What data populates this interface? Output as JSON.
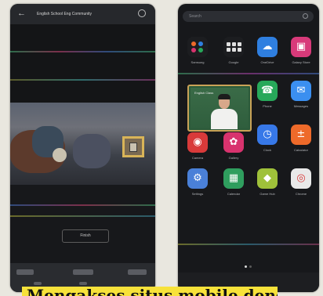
{
  "left_screen": {
    "title": "English School Eng Community",
    "back_icon": "arrow-left-icon",
    "menu_icon": "more-options-icon",
    "video_caption": "",
    "action_button": "Finish",
    "colors": {
      "background": "#1b1d20",
      "frame": "#d8b458"
    }
  },
  "right_screen": {
    "search_placeholder": "Search",
    "search_icon": "search-icon",
    "apps": [
      {
        "label": "Samsung",
        "color": "#1c1d20",
        "icon": "samsung-folder-icon"
      },
      {
        "label": "Google",
        "color": "#1c1d20",
        "icon": "google-folder-icon"
      },
      {
        "label": "OneDrive",
        "color": "#2f7fe0",
        "icon": "cloud-icon"
      },
      {
        "label": "Galaxy Store",
        "color": "#d83a7a",
        "icon": "store-bag-icon"
      },
      {
        "label": "Phone",
        "color": "#27a85a",
        "icon": "phone-icon"
      },
      {
        "label": "Messages",
        "color": "#3b8ff0",
        "icon": "message-icon"
      },
      {
        "label": "Camera",
        "color": "#d93a3a",
        "icon": "camera-icon"
      },
      {
        "label": "Gallery",
        "color": "#d8336e",
        "icon": "flower-icon"
      },
      {
        "label": "Clock",
        "color": "#3778e8",
        "icon": "clock-icon"
      },
      {
        "label": "Calculator",
        "color": "#ee6a2a",
        "icon": "calculator-icon"
      },
      {
        "label": "Settings",
        "color": "#4a80d8",
        "icon": "gear-icon"
      },
      {
        "label": "Calendar",
        "color": "#2f9e5e",
        "icon": "calendar-icon"
      },
      {
        "label": "Game Hub",
        "color": "#9fc13a",
        "icon": "game-icon"
      },
      {
        "label": "Chrome",
        "color": "#e9e9e9",
        "icon": "chrome-icon"
      }
    ],
    "popup_text": "English Class",
    "page_indicator_active": 0
  },
  "caption": {
    "text": "Mengakses situs mobile dengan",
    "color": "#f7e23a"
  }
}
